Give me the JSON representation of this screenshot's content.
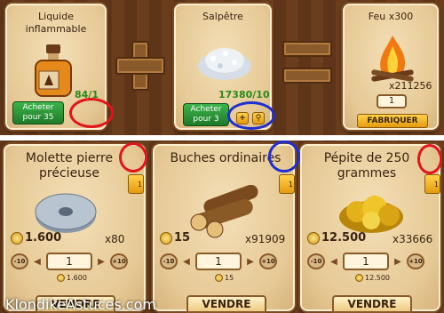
{
  "recipe": {
    "ingredient1": {
      "name": "Liquide\ninflammable",
      "qty": "84/1",
      "buy_label": "Acheter\npour 35"
    },
    "ingredient2": {
      "name": "Salpêtre",
      "qty": "17380/10",
      "buy_label": "Acheter\npour 3"
    },
    "result": {
      "name": "Feu x300",
      "stock": "x211256",
      "qty_value": "1",
      "craft_label": "FABRIQUER"
    }
  },
  "shop": [
    {
      "name": "Molette pierre\nprécieuse",
      "price": "1.600",
      "stock": "x80",
      "qty": "1",
      "unit_price": "1.600",
      "badge": "1",
      "sell": "VENDRE",
      "minus": "-10",
      "plus": "+10"
    },
    {
      "name": "Buches ordinaires",
      "price": "15",
      "stock": "x91909",
      "qty": "1",
      "unit_price": "15",
      "badge": "1",
      "sell": "VENDRE",
      "minus": "-10",
      "plus": "+10"
    },
    {
      "name": "Pépite de 250\ngrammes",
      "price": "12.500",
      "stock": "x33666",
      "qty": "1",
      "unit_price": "12.500",
      "badge": "1",
      "sell": "VENDRE",
      "minus": "-10",
      "plus": "+10"
    }
  ],
  "watermark": "KlondikeAstuces.com",
  "colors": {
    "highlight_red": "#e2141c",
    "highlight_blue": "#1f2fd0",
    "button_green": "#2a9a38",
    "button_yellow": "#f0b020"
  },
  "icons": {
    "add": "plus-icon",
    "search": "magnifier-icon"
  }
}
